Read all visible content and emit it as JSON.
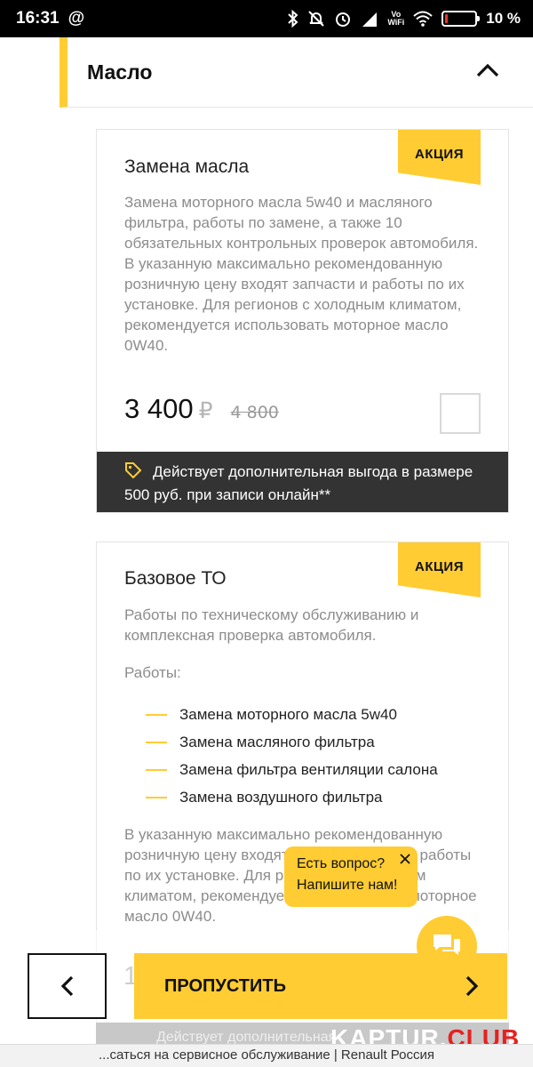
{
  "status_bar": {
    "time": "16:31",
    "at_symbol": "@",
    "network_label_top": "Vo",
    "network_label_bottom": "WiFi",
    "battery": "10 %",
    "battery_level": 0.1
  },
  "accordion": {
    "title": "Масло"
  },
  "cards": [
    {
      "badge": "АКЦИЯ",
      "title": "Замена масла",
      "description": "Замена моторного масла 5w40 и масляного фильтра, работы по замене, а также 10 обязательных контрольных проверок автомобиля. В указанную максимально рекомендованную розничную цену входят запчасти и работы по их установке. Для регионов с холодным климатом, рекомендуется использовать моторное масло 0W40.",
      "price": "3 400",
      "currency": "₽",
      "old_price": "4 800",
      "bonus": "Действует дополнительная выгода в размере 500 руб. при записи онлайн**"
    },
    {
      "badge": "АКЦИЯ",
      "title": "Базовое ТО",
      "description": "Работы по техническому обслуживанию и комплексная проверка автомобиля.",
      "works_label": "Работы:",
      "works": [
        "Замена моторного масла 5w40",
        "Замена масляного фильтра",
        "Замена фильтра вентиляции салона",
        "Замена воздушного фильтра"
      ],
      "description2": "В указанную максимально рекомендованную розничную цену входят запасные части и работы по их установке. Для регионов с холодным климатом, рекомендуется использовать моторное масло 0W40.",
      "price_partial": "1"
    }
  ],
  "chat": {
    "line1": "Есть вопрос?",
    "line2": "Напишите нам!"
  },
  "nav": {
    "skip_label": "ПРОПУСТИТЬ"
  },
  "faded_banner": "Действует дополнительная",
  "watermark": {
    "part1": "KAPTUR.",
    "part2": "CLUB"
  },
  "page_title": "...саться на сервисное обслуживание | Renault Россия",
  "colors": {
    "accent": "#ffcc33",
    "dark_banner": "#333333",
    "muted_text": "#8c8c8c"
  }
}
